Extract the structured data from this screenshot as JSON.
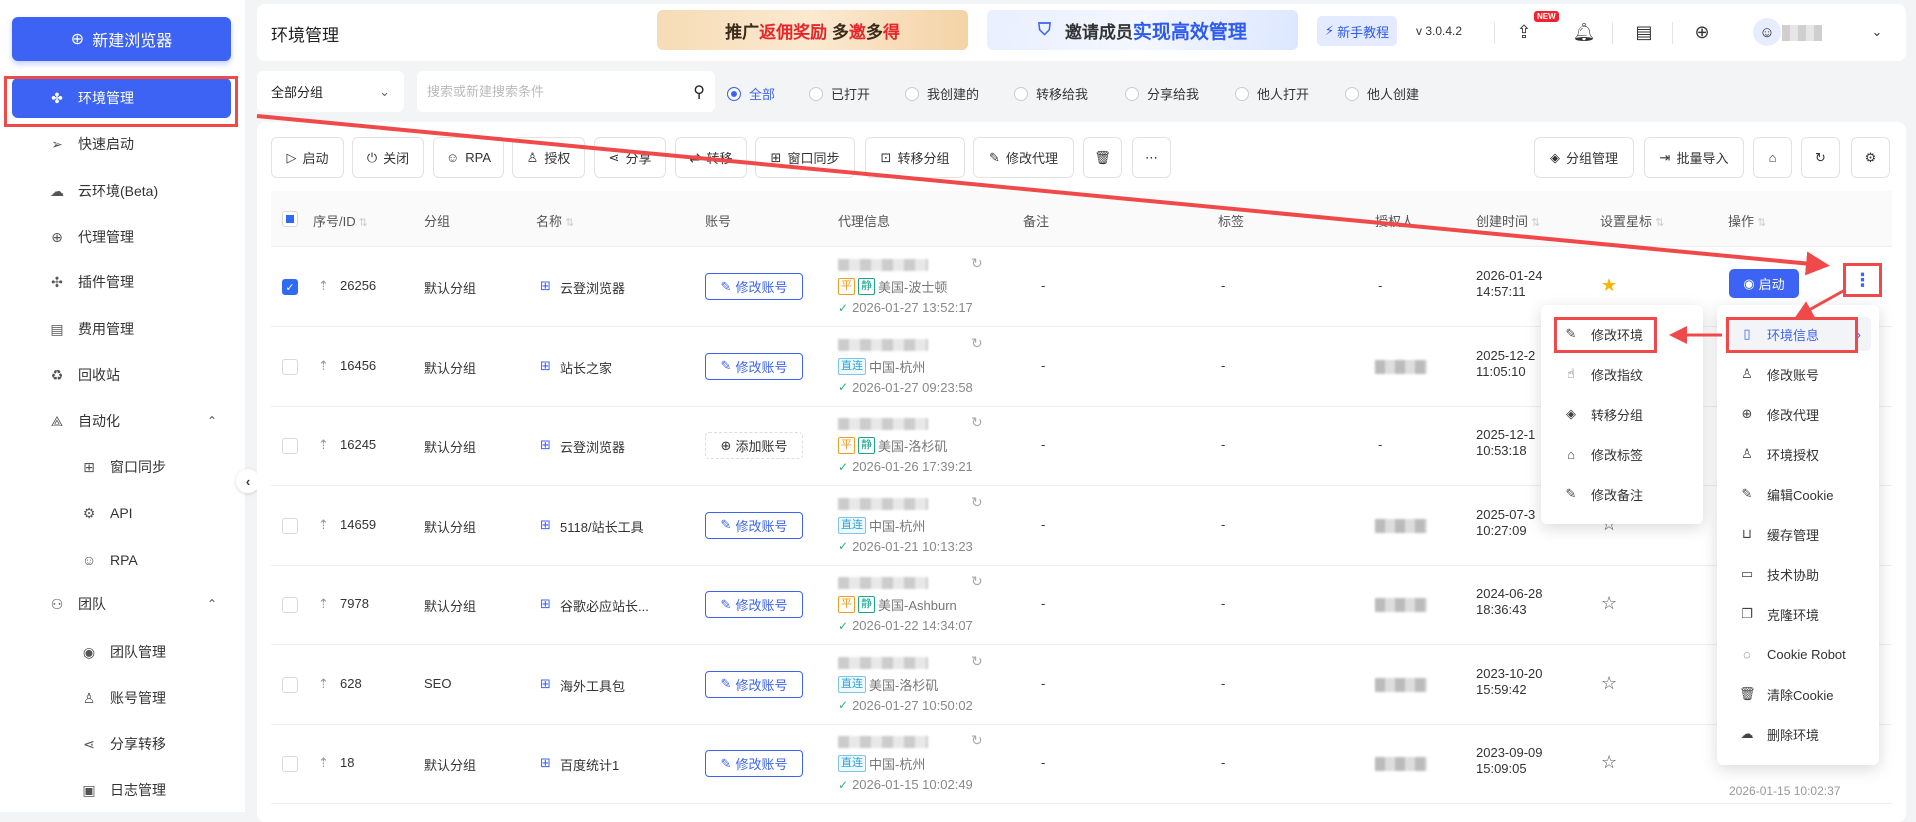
{
  "sidebar": {
    "new_button": "新建浏览器",
    "items": [
      {
        "label": "环境管理",
        "icon": "flower-icon",
        "glyph": "✤",
        "active": true
      },
      {
        "label": "快速启动",
        "icon": "send-icon",
        "glyph": "➢"
      },
      {
        "label": "云环境(Beta)",
        "icon": "cloud-icon",
        "glyph": "☁"
      },
      {
        "label": "代理管理",
        "icon": "globe-icon",
        "glyph": "⊕"
      },
      {
        "label": "插件管理",
        "icon": "puzzle-icon",
        "glyph": "✣"
      },
      {
        "label": "费用管理",
        "icon": "bill-icon",
        "glyph": "▤"
      },
      {
        "label": "回收站",
        "icon": "recycle-icon",
        "glyph": "♻"
      },
      {
        "label": "自动化",
        "icon": "automation-icon",
        "glyph": "⟁",
        "caret": "^"
      },
      {
        "label": "窗口同步",
        "icon": "window-sync-icon",
        "glyph": "⊞",
        "sub": true
      },
      {
        "label": "API",
        "icon": "api-icon",
        "glyph": "⚙",
        "sub": true
      },
      {
        "label": "RPA",
        "icon": "robot-icon",
        "glyph": "☺",
        "sub": true
      },
      {
        "label": "团队",
        "icon": "team-icon",
        "glyph": "⚇",
        "caret": "^"
      },
      {
        "label": "团队管理",
        "icon": "team-manage-icon",
        "glyph": "◉",
        "sub": true
      },
      {
        "label": "账号管理",
        "icon": "user-icon",
        "glyph": "♙",
        "sub": true
      },
      {
        "label": "分享转移",
        "icon": "share-icon",
        "glyph": "⋖",
        "sub": true
      },
      {
        "label": "日志管理",
        "icon": "log-icon",
        "glyph": "▣",
        "sub": true
      }
    ]
  },
  "header": {
    "title": "环境管理",
    "banner1": {
      "a": "推广",
      "b": "返佣奖励",
      "c": "多",
      "d": "邀",
      "e": "多",
      "f": "得"
    },
    "banner2": {
      "a": "邀请成员",
      "b": "实现高效管理"
    },
    "tutorial": "新手教程",
    "version": "v 3.0.4.2",
    "new_badge": "NEW"
  },
  "filters": {
    "group_select": "全部分组",
    "search_placeholder": "搜索或新建搜索条件",
    "radios": [
      "全部",
      "已打开",
      "我创建的",
      "转移给我",
      "分享给我",
      "他人打开",
      "他人创建"
    ],
    "selected": "全部"
  },
  "toolbar": {
    "left": [
      {
        "label": "启动",
        "icon": "play-icon",
        "glyph": "▷"
      },
      {
        "label": "关闭",
        "icon": "power-icon",
        "glyph": "⏻"
      },
      {
        "label": "RPA",
        "icon": "robot-icon",
        "glyph": "☺"
      },
      {
        "label": "授权",
        "icon": "user-check-icon",
        "glyph": "♙"
      },
      {
        "label": "分享",
        "icon": "share-icon",
        "glyph": "⋖"
      },
      {
        "label": "转移",
        "icon": "transfer-icon",
        "glyph": "⇄"
      },
      {
        "label": "窗口同步",
        "icon": "window-sync-icon",
        "glyph": "⊞"
      },
      {
        "label": "转移分组",
        "icon": "move-group-icon",
        "glyph": "⊡"
      },
      {
        "label": "修改代理",
        "icon": "edit-icon",
        "glyph": "✎"
      },
      {
        "label": "",
        "icon": "trash-icon",
        "glyph": "🗑"
      },
      {
        "label": "",
        "icon": "more-icon",
        "glyph": "⋯"
      }
    ],
    "right": [
      {
        "label": "分组管理",
        "icon": "layers-icon",
        "glyph": "◈"
      },
      {
        "label": "批量导入",
        "icon": "import-icon",
        "glyph": "⇥"
      },
      {
        "label": "",
        "icon": "tag-icon",
        "glyph": "⌂"
      },
      {
        "label": "",
        "icon": "refresh-icon",
        "glyph": "↻"
      },
      {
        "label": "",
        "icon": "settings-icon",
        "glyph": "⚙"
      }
    ]
  },
  "table": {
    "columns": [
      "序号/ID",
      "分组",
      "名称",
      "账号",
      "代理信息",
      "备注",
      "标签",
      "授权人",
      "创建时间",
      "设置星标",
      "操作"
    ],
    "rows": [
      {
        "id": "26256",
        "group": "默认分组",
        "name": "云登浏览器",
        "account": "修改账号",
        "tags": [
          "平",
          "静"
        ],
        "location": "美国-波士顿",
        "proxy_time": "2026-01-27 13:52:17",
        "note": "-",
        "label": "-",
        "authorizer": "-",
        "created": [
          "2026-01-24",
          "14:57:11"
        ],
        "starred": true,
        "checked": true,
        "action": "启动"
      },
      {
        "id": "16456",
        "group": "默认分组",
        "name": "站长之家",
        "account": "修改账号",
        "tags": [
          "直连"
        ],
        "location": "中国-杭州",
        "proxy_time": "2026-01-27 09:23:58",
        "note": "-",
        "label": "-",
        "authorizer": null,
        "created": [
          "2025-12-2",
          "11:05:10"
        ],
        "starred": false
      },
      {
        "id": "16245",
        "group": "默认分组",
        "name": "云登浏览器",
        "account": "添加账号",
        "add": true,
        "tags": [
          "平",
          "静"
        ],
        "location": "美国-洛杉矶",
        "proxy_time": "2026-01-26 17:39:21",
        "note": "-",
        "label": "-",
        "authorizer": "-",
        "created": [
          "2025-12-1",
          "10:53:18"
        ],
        "starred": false
      },
      {
        "id": "14659",
        "group": "默认分组",
        "name": "5118/站长工具",
        "account": "修改账号",
        "tags": [
          "直连"
        ],
        "location": "中国-杭州",
        "proxy_time": "2026-01-21 10:13:23",
        "note": "-",
        "label": "-",
        "authorizer": null,
        "created": [
          "2025-07-3",
          "10:27:09"
        ],
        "starred": false
      },
      {
        "id": "7978",
        "group": "默认分组",
        "name": "谷歌必应站长...",
        "account": "修改账号",
        "tags": [
          "平",
          "静"
        ],
        "location": "美国-Ashburn",
        "proxy_time": "2026-01-22 14:34:07",
        "note": "-",
        "label": "-",
        "authorizer": null,
        "created": [
          "2024-06-28",
          "18:36:43"
        ],
        "starred": false
      },
      {
        "id": "628",
        "group": "SEO",
        "name": "海外工具包",
        "account": "修改账号",
        "tags": [
          "直连"
        ],
        "location": "美国-洛杉矶",
        "proxy_time": "2026-01-27 10:50:02",
        "note": "-",
        "label": "-",
        "authorizer": null,
        "created": [
          "2023-10-20",
          "15:59:42"
        ],
        "starred": false
      },
      {
        "id": "18",
        "group": "默认分组",
        "name": "百度统计1",
        "account": "修改账号",
        "tags": [
          "直连"
        ],
        "location": "中国-杭州",
        "proxy_time": "2026-01-15 10:02:49",
        "note": "-",
        "label": "-",
        "authorizer": null,
        "created": [
          "2023-09-09",
          "15:09:05"
        ],
        "starred": false,
        "last_open": "2026-01-15 10:02:37"
      }
    ]
  },
  "context_menu": {
    "items": [
      {
        "label": "环境信息",
        "icon": "file-icon",
        "glyph": "▯",
        "highlight": true,
        "submenu": true
      },
      {
        "label": "修改账号",
        "icon": "user-icon",
        "glyph": "♙"
      },
      {
        "label": "修改代理",
        "icon": "globe-icon",
        "glyph": "⊕"
      },
      {
        "label": "环境授权",
        "icon": "user-check-icon",
        "glyph": "♙"
      },
      {
        "label": "编辑Cookie",
        "icon": "pen-icon",
        "glyph": "✎"
      },
      {
        "label": "缓存管理",
        "icon": "basket-icon",
        "glyph": "⊔"
      },
      {
        "label": "技术协助",
        "icon": "terminal-icon",
        "glyph": "▭"
      },
      {
        "label": "克隆环境",
        "icon": "copy-icon",
        "glyph": "❐"
      },
      {
        "label": "Cookie Robot",
        "icon": "cookie-icon",
        "glyph": "◌"
      },
      {
        "label": "清除Cookie",
        "icon": "trash-icon",
        "glyph": "🗑"
      },
      {
        "label": "删除环境",
        "icon": "cloud-delete-icon",
        "glyph": "☁"
      }
    ],
    "submenu": [
      {
        "label": "修改环境",
        "icon": "edit-icon",
        "glyph": "✎"
      },
      {
        "label": "修改指纹",
        "icon": "fingerprint-icon",
        "glyph": "☝"
      },
      {
        "label": "转移分组",
        "icon": "layers-icon",
        "glyph": "◈"
      },
      {
        "label": "修改标签",
        "icon": "tag-icon",
        "glyph": "⌂"
      },
      {
        "label": "修改备注",
        "icon": "pen-icon",
        "glyph": "✎"
      }
    ]
  },
  "colors": {
    "primary": "#3d63f5",
    "annotation": "#f0494a",
    "star": "#f7b500"
  }
}
